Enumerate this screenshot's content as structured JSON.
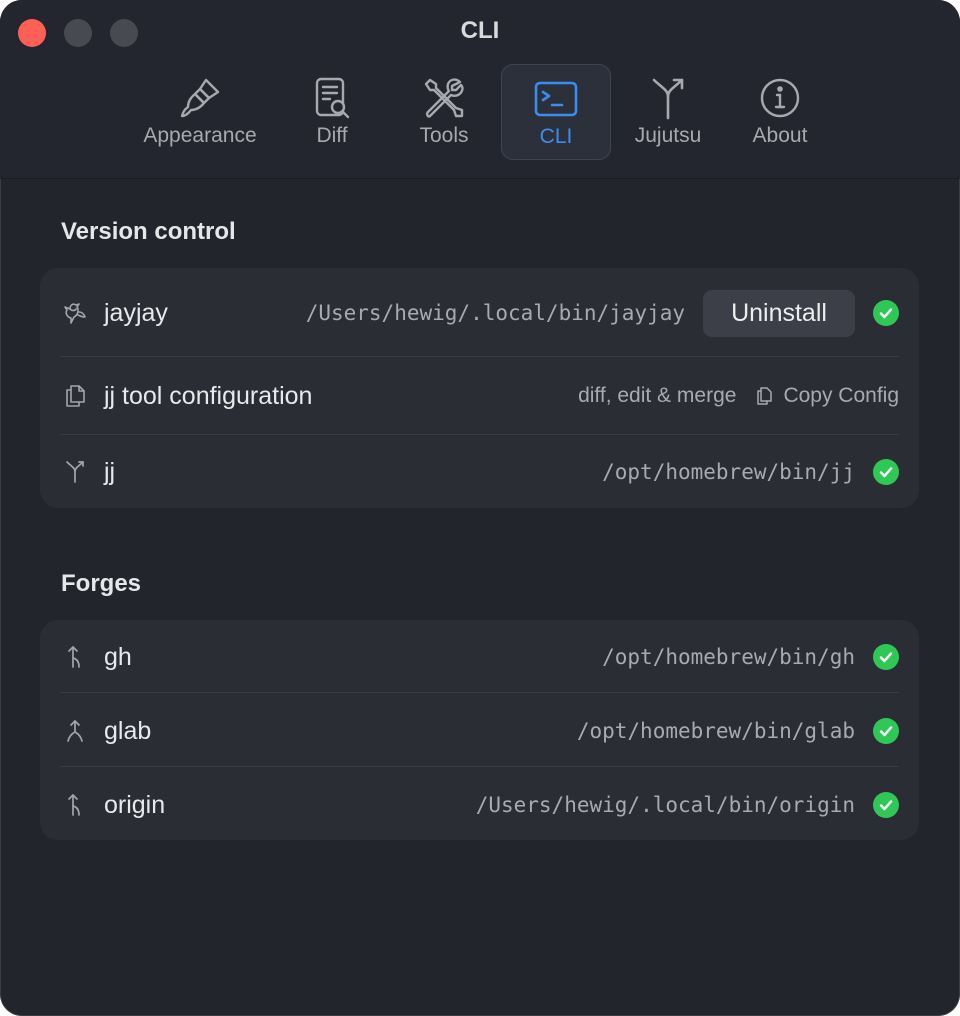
{
  "window": {
    "title": "CLI"
  },
  "tabs": [
    {
      "label": "Appearance",
      "icon": "paintbrush-icon"
    },
    {
      "label": "Diff",
      "icon": "doc-magnifier-icon"
    },
    {
      "label": "Tools",
      "icon": "wrench-screwdriver-icon"
    },
    {
      "label": "CLI",
      "icon": "terminal-icon",
      "active": true
    },
    {
      "label": "Jujutsu",
      "icon": "branch-merge-icon"
    },
    {
      "label": "About",
      "icon": "info-icon"
    }
  ],
  "version_control": {
    "title": "Version control",
    "rows": [
      {
        "name": "jayjay",
        "icon": "bird-icon",
        "path": "/Users/hewig/.local/bin/jayjay",
        "button": "Uninstall",
        "status": "installed"
      },
      {
        "name": "jj tool configuration",
        "icon": "documents-icon",
        "detail": "diff, edit & merge",
        "button": "Copy Config"
      },
      {
        "name": "jj",
        "icon": "branch-merge-icon",
        "path": "/opt/homebrew/bin/jj",
        "status": "installed"
      }
    ]
  },
  "forges": {
    "title": "Forges",
    "rows": [
      {
        "name": "gh",
        "icon": "branch-arrow-icon",
        "path": "/opt/homebrew/bin/gh",
        "status": "installed"
      },
      {
        "name": "glab",
        "icon": "merge-arrow-icon",
        "path": "/opt/homebrew/bin/glab",
        "status": "installed"
      },
      {
        "name": "origin",
        "icon": "branch-arrow-icon",
        "path": "/Users/hewig/.local/bin/origin",
        "status": "installed"
      }
    ]
  },
  "colors": {
    "accent": "#3b8cf0",
    "success": "#2fc857",
    "background": "#22252c",
    "card": "#2a2d34"
  }
}
